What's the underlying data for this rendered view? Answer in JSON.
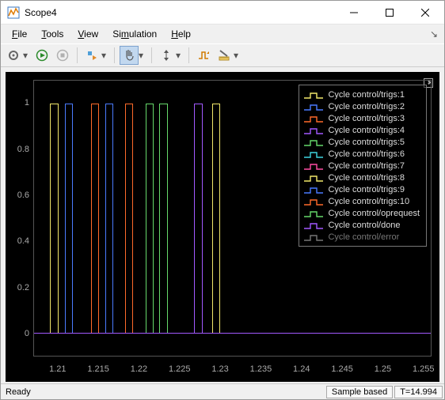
{
  "window": {
    "title": "Scope4",
    "status_ready": "Ready",
    "status_mode": "Sample based",
    "status_time": "T=14.994"
  },
  "menubar": {
    "file": "File",
    "tools": "Tools",
    "view": "View",
    "simulation": "Simulation",
    "help": "Help"
  },
  "toolbar": {
    "config": "configure-icon",
    "run": "play",
    "stop": "stop",
    "step_fwd": "step-forward",
    "pan": "pan",
    "zoom_y": "zoom-y",
    "scale_axes": "scale-axes",
    "triggers": "triggers",
    "measure": "measure"
  },
  "axes": {
    "yticks": [
      "0",
      "0.2",
      "0.4",
      "0.6",
      "0.8",
      "1"
    ],
    "xticks": [
      "1.21",
      "1.215",
      "1.22",
      "1.225",
      "1.23",
      "1.235",
      "1.24",
      "1.245",
      "1.25",
      "1.255"
    ]
  },
  "legend": [
    {
      "label": "Cycle control/trigs:1",
      "color": "#f2e96b"
    },
    {
      "label": "Cycle control/trigs:2",
      "color": "#4a7bff"
    },
    {
      "label": "Cycle control/trigs:3",
      "color": "#ff6a2a"
    },
    {
      "label": "Cycle control/trigs:4",
      "color": "#a259ff"
    },
    {
      "label": "Cycle control/trigs:5",
      "color": "#66d96b"
    },
    {
      "label": "Cycle control/trigs:6",
      "color": "#3fd6e0"
    },
    {
      "label": "Cycle control/trigs:7",
      "color": "#ff4da6"
    },
    {
      "label": "Cycle control/trigs:8",
      "color": "#f2e96b"
    },
    {
      "label": "Cycle control/trigs:9",
      "color": "#4a7bff"
    },
    {
      "label": "Cycle control/trigs:10",
      "color": "#ff6a2a"
    },
    {
      "label": "Cycle control/oprequest",
      "color": "#66d96b"
    },
    {
      "label": "Cycle control/done",
      "color": "#a259ff"
    },
    {
      "label": "Cycle control/error",
      "color": "#777777",
      "dim": true
    }
  ],
  "chart_data": {
    "type": "line",
    "title": "",
    "xlabel": "",
    "ylabel": "",
    "xlim": [
      1.207,
      1.256
    ],
    "ylim": [
      -0.1,
      1.1
    ],
    "base_value": 0,
    "pulse_height": 1,
    "series": [
      {
        "name": "Cycle control/trigs:1",
        "color": "#f2e96b",
        "pulse_start": 1.209,
        "pulse_end": 1.21
      },
      {
        "name": "Cycle control/trigs:2",
        "color": "#4a7bff",
        "pulse_start": 1.2108,
        "pulse_end": 1.2118
      },
      {
        "name": "Cycle control/trigs:3",
        "color": "#ff6a2a",
        "pulse_start": 1.214,
        "pulse_end": 1.215
      },
      {
        "name": "Cycle control/trigs:9",
        "color": "#4a7bff",
        "pulse_start": 1.2158,
        "pulse_end": 1.2168
      },
      {
        "name": "Cycle control/trigs:10",
        "color": "#ff6a2a",
        "pulse_start": 1.2182,
        "pulse_end": 1.2192
      },
      {
        "name": "Cycle control/trigs:5",
        "color": "#66d96b",
        "pulse_start": 1.2208,
        "pulse_end": 1.2218
      },
      {
        "name": "Cycle control/oprequest",
        "color": "#66d96b",
        "pulse_start": 1.2225,
        "pulse_end": 1.2235
      },
      {
        "name": "Cycle control/trigs:4",
        "color": "#a259ff",
        "pulse_start": 1.2268,
        "pulse_end": 1.2278
      },
      {
        "name": "Cycle control/trigs:8",
        "color": "#f2e96b",
        "pulse_start": 1.229,
        "pulse_end": 1.23
      },
      {
        "name": "Cycle control/done",
        "color": "#a259ff",
        "pulse_start": 1.207,
        "pulse_end": 1.207,
        "flat": true
      },
      {
        "name": "Cycle control/error",
        "color": "#777777",
        "pulse_start": 1.207,
        "pulse_end": 1.207,
        "flat": true
      }
    ]
  }
}
